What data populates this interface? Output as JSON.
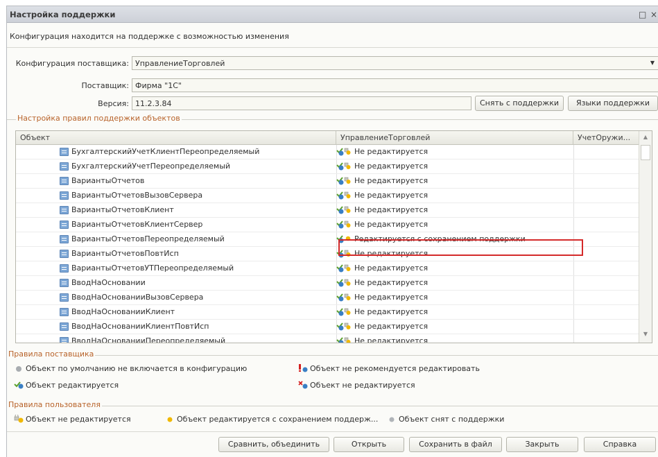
{
  "window": {
    "title": "Настройка поддержки",
    "info": "Конфигурация находится на поддержке с возможностью изменения",
    "controls": [
      "□",
      "×"
    ]
  },
  "form": {
    "vendor_config_label": "Конфигурация поставщика:",
    "vendor_config_value": "УправлениеТорговлей",
    "vendor_label": "Поставщик:",
    "vendor_value": "Фирма \"1С\"",
    "version_label": "Версия:",
    "version_value": "11.2.3.84",
    "remove_support_button": "Снять с поддержки",
    "support_languages_button": "Языки поддержки"
  },
  "rules_group": {
    "title": "Настройка правил поддержки объектов",
    "columns": [
      "Объект",
      "УправлениеТорговлей",
      "УчетОружи..."
    ],
    "rows": [
      {
        "object": "БухгалтерскийУчетКлиентПереопределяемый",
        "status": "Не редактируется"
      },
      {
        "object": "БухгалтерскийУчетПереопределяемый",
        "status": "Не редактируется"
      },
      {
        "object": "ВариантыОтчетов",
        "status": "Не редактируется"
      },
      {
        "object": "ВариантыОтчетовВызовСервера",
        "status": "Не редактируется"
      },
      {
        "object": "ВариантыОтчетовКлиент",
        "status": "Не редактируется"
      },
      {
        "object": "ВариантыОтчетовКлиентСервер",
        "status": "Не редактируется"
      },
      {
        "object": "ВариантыОтчетовПереопределяемый",
        "status": "Редактируется с сохранением поддержки"
      },
      {
        "object": "ВариантыОтчетовПовтИсп",
        "status": "Не редактируется"
      },
      {
        "object": "ВариантыОтчетовУТПереопределяемый",
        "status": "Не редактируется"
      },
      {
        "object": "ВводНаОсновании",
        "status": "Не редактируется"
      },
      {
        "object": "ВводНаОснованииВызовСервера",
        "status": "Не редактируется"
      },
      {
        "object": "ВводНаОснованииКлиент",
        "status": "Не редактируется"
      },
      {
        "object": "ВводНаОснованииКлиентПовтИсп",
        "status": "Не редактируется"
      },
      {
        "object": "ВводНаОснованииПереопределяемый",
        "status": "Не редактируется"
      }
    ]
  },
  "vendor_rules": {
    "title": "Правила поставщика",
    "items": [
      "Объект по умолчанию не включается в конфигурацию",
      "Объект не рекомендуется редактировать",
      "Объект редактируется",
      "Объект не редактируется"
    ]
  },
  "user_rules": {
    "title": "Правила пользователя",
    "items": [
      "Объект не редактируется",
      "Объект редактируется с сохранением поддерж...",
      "Объект снят с поддержки"
    ]
  },
  "footer": {
    "compare_button": "Сравнить, объединить",
    "open_button": "Открыть",
    "save_button": "Сохранить в файл",
    "close_button": "Закрыть",
    "help_button": "Справка"
  },
  "colors": {
    "group_title": "#b8632a",
    "highlight_border": "#d42a2a"
  }
}
